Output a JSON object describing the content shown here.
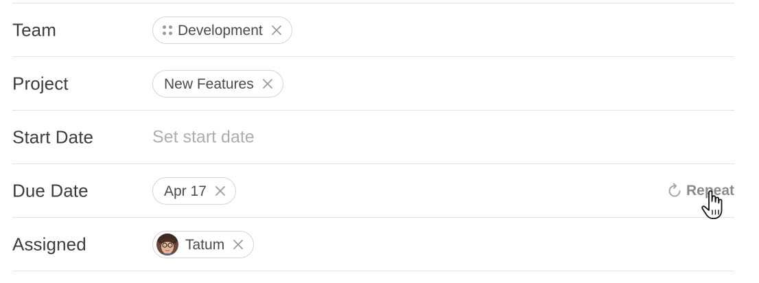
{
  "fields": {
    "team": {
      "label": "Team",
      "chip": "Development"
    },
    "project": {
      "label": "Project",
      "chip": "New Features"
    },
    "start_date": {
      "label": "Start Date",
      "placeholder": "Set start date"
    },
    "due_date": {
      "label": "Due Date",
      "chip": "Apr 17",
      "repeat_label": "Repeat"
    },
    "assigned": {
      "label": "Assigned",
      "chip": "Tatum"
    }
  },
  "icons": {
    "team_icon": "grid-dots-icon",
    "remove_icon": "close-icon",
    "repeat_icon": "repeat-icon",
    "cursor": "hand-pointer-icon"
  },
  "colors": {
    "label_text": "#3c3c3c",
    "chip_border": "#d3d3d3",
    "placeholder_text": "#adadad",
    "divider": "#e2e2e2",
    "repeat_text": "#8a8a8a"
  }
}
